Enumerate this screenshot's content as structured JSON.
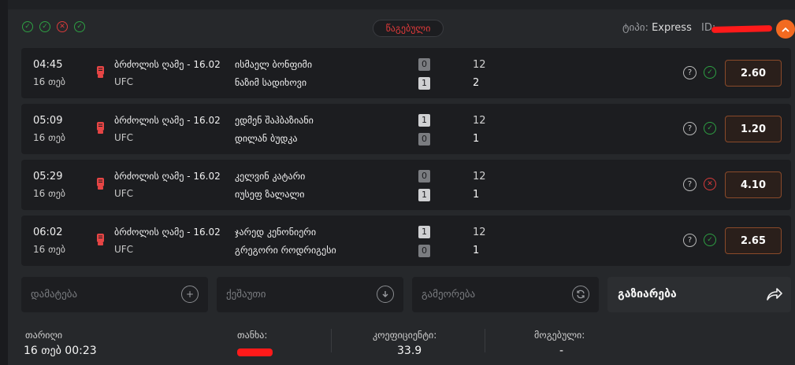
{
  "header": {
    "statuses": [
      "win",
      "win",
      "loss",
      "win"
    ],
    "status_label": "წაგებული",
    "type_label": "ტიპი:",
    "type_value": "Express",
    "id_label": "ID:",
    "collapse_icon": "chevron-up-icon"
  },
  "bets": [
    {
      "time": "04:45",
      "date": "16 თებ",
      "event": "ბრძოლის ღამე - 16.02",
      "league": "UFC",
      "fighter1": "ისმაელ ბონფიმი",
      "fighter2": "ნაზიმ სადიხოვი",
      "score1": "0",
      "score2": "1",
      "period1": "12",
      "period2": "2",
      "result": "win",
      "odd": "2.60"
    },
    {
      "time": "05:09",
      "date": "16 თებ",
      "event": "ბრძოლის ღამე - 16.02",
      "league": "UFC",
      "fighter1": "ედმენ შაჰბაზიანი",
      "fighter2": "დილან ბუდკა",
      "score1": "1",
      "score2": "0",
      "period1": "12",
      "period2": "1",
      "result": "win",
      "odd": "1.20"
    },
    {
      "time": "05:29",
      "date": "16 თებ",
      "event": "ბრძოლის ღამე - 16.02",
      "league": "UFC",
      "fighter1": "კელვინ კატარი",
      "fighter2": "იუსეფ ზალალი",
      "score1": "0",
      "score2": "1",
      "period1": "12",
      "period2": "1",
      "result": "loss",
      "odd": "4.10"
    },
    {
      "time": "06:02",
      "date": "16 თებ",
      "event": "ბრძოლის ღამე - 16.02",
      "league": "UFC",
      "fighter1": "ჯარედ კენონიერი",
      "fighter2": "გრეგორი როდრიგესი",
      "score1": "1",
      "score2": "0",
      "period1": "12",
      "period2": "1",
      "result": "win",
      "odd": "2.65"
    }
  ],
  "actions": {
    "add_label": "დამატება",
    "save_label": "ქეშაუთი",
    "repeat_label": "გამეორება",
    "share_label": "გაზიარება"
  },
  "summary": {
    "date_label": "თარიღი",
    "date_value": "16 თებ 00:23",
    "stake_label": "თანხა:",
    "coef_label": "კოეფიციენტი:",
    "coef_value": "33.9",
    "win_label": "მოგებული:",
    "win_value": "-"
  },
  "colors": {
    "accent": "#f26a21",
    "win": "#2ea043",
    "loss": "#d93b3b",
    "status_text": "#e03a3a"
  }
}
